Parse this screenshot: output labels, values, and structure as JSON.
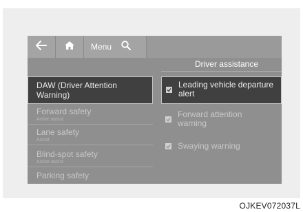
{
  "nav": {
    "back_icon": "arrow-left-icon",
    "home_icon": "home-icon",
    "menu_label": "Menu",
    "search_icon": "search-icon"
  },
  "header": {
    "title": "Driver assistance"
  },
  "left_menu": {
    "items": [
      {
        "label": "DAW (Driver Attention Warning)",
        "sub": "",
        "selected": true
      },
      {
        "label": "Forward safety",
        "sub": "Active assist",
        "selected": false
      },
      {
        "label": "Lane safety",
        "sub": "Assist",
        "selected": false
      },
      {
        "label": "Blind-spot safety",
        "sub": "Active assist",
        "selected": false
      },
      {
        "label": "Parking safety",
        "sub": "",
        "selected": false
      }
    ]
  },
  "options": {
    "items": [
      {
        "label": "Leading vehicle departure alert",
        "checked": true,
        "selected": true
      },
      {
        "label": "Forward attention warning",
        "checked": true,
        "selected": false
      },
      {
        "label": "Swaying warning",
        "checked": true,
        "selected": false
      }
    ]
  },
  "caption": "OJKEV072037L"
}
